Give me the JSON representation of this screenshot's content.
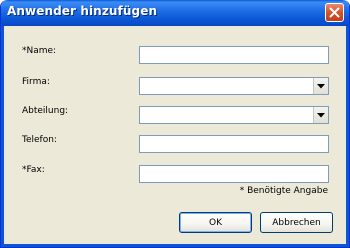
{
  "window": {
    "title": "Anwender hinzufügen"
  },
  "form": {
    "name": {
      "label": "*Name:",
      "value": ""
    },
    "company": {
      "label": "Firma:",
      "value": ""
    },
    "department": {
      "label": "Abteilung:",
      "value": ""
    },
    "phone": {
      "label": "Telefon:",
      "value": ""
    },
    "fax": {
      "label": "*Fax:",
      "value": ""
    },
    "required_note": "* Benötigte Angabe"
  },
  "buttons": {
    "ok_label": "OK",
    "cancel_label": "Abbrechen"
  },
  "icons": {
    "close": "close-icon",
    "dropdown": "chevron-down-icon"
  },
  "colors": {
    "titlebar": "#0a56d4",
    "close": "#d6522c",
    "background": "#ece9d8"
  }
}
